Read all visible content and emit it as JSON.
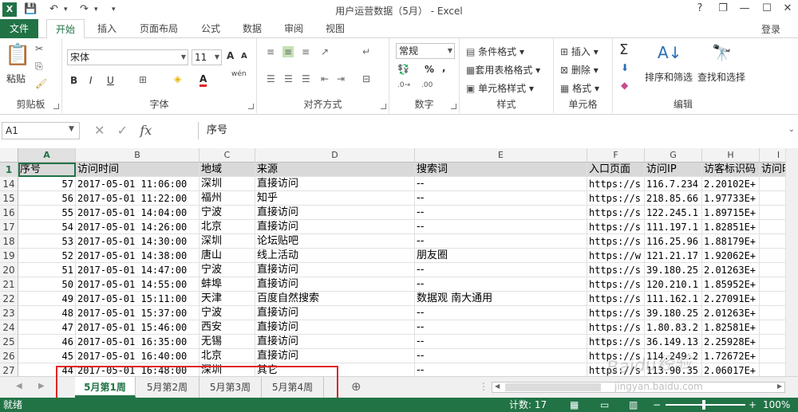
{
  "window": {
    "title": "用户运营数据（5月） - Excel",
    "help": "?",
    "restore": "❐",
    "minimize": "—",
    "maximize": "☐",
    "close": "✕"
  },
  "ribbon_tabs": {
    "file": "文件",
    "tabs": [
      "开始",
      "插入",
      "页面布局",
      "公式",
      "数据",
      "审阅",
      "视图"
    ],
    "active": "开始",
    "login": "登录"
  },
  "ribbon": {
    "clipboard": {
      "label": "剪贴板",
      "paste": "粘贴"
    },
    "font": {
      "label": "字体",
      "name": "宋体",
      "size": "11",
      "bold": "B",
      "italic": "I",
      "underline": "U",
      "grow": "A",
      "shrink": "A",
      "color_a": "A",
      "wen": "wén"
    },
    "align": {
      "label": "对齐方式"
    },
    "number": {
      "label": "数字",
      "format": "常规",
      "percent": "%",
      "comma": ","
    },
    "styles": {
      "label": "样式",
      "cond": "条件格式",
      "table": "套用表格格式",
      "cell": "单元格样式"
    },
    "cells": {
      "label": "单元格",
      "insert": "插入",
      "delete": "删除",
      "format": "格式"
    },
    "editing": {
      "label": "编辑",
      "sort": "排序和筛选",
      "find": "查找和选择",
      "sigma": "Σ"
    }
  },
  "formula_bar": {
    "namebox": "A1",
    "fx": "fx",
    "content": "序号"
  },
  "columns": [
    "A",
    "B",
    "C",
    "D",
    "E",
    "F",
    "G",
    "H",
    "I"
  ],
  "headers": [
    "序号",
    "访问时间",
    "地域",
    "来源",
    "搜索词",
    "入口页面",
    "访问IP",
    "访客标识码",
    "访问时"
  ],
  "row_numbers": [
    "1",
    "14",
    "15",
    "16",
    "17",
    "18",
    "19",
    "20",
    "21",
    "22",
    "23",
    "24",
    "25",
    "26",
    "27"
  ],
  "rows": [
    [
      "57",
      "2017-05-01 11:06:00",
      "深圳",
      "直接访问",
      "--",
      "https://s",
      "116.7.234",
      "2.20102E+"
    ],
    [
      "56",
      "2017-05-01 11:22:00",
      "福州",
      "知乎",
      "--",
      "https://s",
      "218.85.66",
      "1.97733E+"
    ],
    [
      "55",
      "2017-05-01 14:04:00",
      "宁波",
      "直接访问",
      "--",
      "https://s",
      "122.245.1",
      "1.89715E+"
    ],
    [
      "54",
      "2017-05-01 14:26:00",
      "北京",
      "直接访问",
      "--",
      "https://s",
      "111.197.1",
      "1.82851E+"
    ],
    [
      "53",
      "2017-05-01 14:30:00",
      "深圳",
      "论坛贴吧",
      "--",
      "https://s",
      "116.25.96",
      "1.88179E+"
    ],
    [
      "52",
      "2017-05-01 14:38:00",
      "唐山",
      "线上活动",
      "朋友圈",
      "https://w",
      "121.21.17",
      "1.92062E+"
    ],
    [
      "51",
      "2017-05-01 14:47:00",
      "宁波",
      "直接访问",
      "--",
      "https://s",
      "39.180.25",
      "2.01263E+"
    ],
    [
      "50",
      "2017-05-01 14:55:00",
      "蚌埠",
      "直接访问",
      "--",
      "https://s",
      "120.210.1",
      "1.85952E+"
    ],
    [
      "49",
      "2017-05-01 15:11:00",
      "天津",
      "百度自然搜索",
      "数据观 南大通用",
      "https://s",
      "111.162.1",
      "2.27091E+"
    ],
    [
      "48",
      "2017-05-01 15:37:00",
      "宁波",
      "直接访问",
      "--",
      "https://s",
      "39.180.25",
      "2.01263E+"
    ],
    [
      "47",
      "2017-05-01 15:46:00",
      "西安",
      "直接访问",
      "--",
      "https://s",
      "1.80.83.2",
      "1.82581E+"
    ],
    [
      "46",
      "2017-05-01 16:35:00",
      "无锡",
      "直接访问",
      "--",
      "https://s",
      "36.149.13",
      "2.25928E+"
    ],
    [
      "45",
      "2017-05-01 16:40:00",
      "北京",
      "直接访问",
      "--",
      "https://s",
      "114.249.2",
      "1.72672E+"
    ],
    [
      "44",
      "2017-05-01 16:48:00",
      "深圳",
      "其它",
      "--",
      "https://s",
      "113.90.35",
      "2.06017E+"
    ]
  ],
  "sheets": [
    "5月第1周",
    "5月第2周",
    "5月第3周",
    "5月第4周"
  ],
  "active_sheet": "5月第1周",
  "status": {
    "ready": "就绪",
    "count": "计数: 17",
    "zoom": "100%"
  },
  "watermark": {
    "line1": "Baidu经验",
    "line2": "jingyan.baidu.com"
  },
  "colors": {
    "excel_green": "#217346",
    "highlight_red": "#e02424"
  }
}
